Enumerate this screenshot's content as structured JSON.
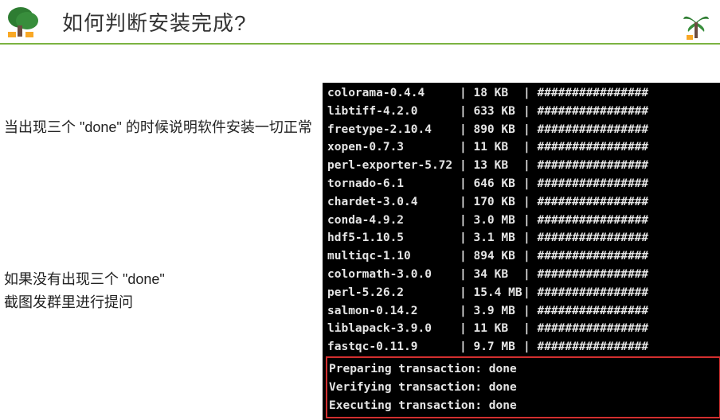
{
  "header": {
    "title": "如何判断安装完成?"
  },
  "instructions": {
    "line1": "当出现三个 \"done\" 的时候说明软件安装一切正常",
    "line2a": "如果没有出现三个 \"done\"",
    "line2b": "截图发群里进行提问"
  },
  "packages": [
    {
      "name": "colorama-0.4.4",
      "size": "18 KB"
    },
    {
      "name": "libtiff-4.2.0",
      "size": "633 KB"
    },
    {
      "name": "freetype-2.10.4",
      "size": "890 KB"
    },
    {
      "name": "xopen-0.7.3",
      "size": "11 KB"
    },
    {
      "name": "perl-exporter-5.72",
      "size": "13 KB"
    },
    {
      "name": "tornado-6.1",
      "size": "646 KB"
    },
    {
      "name": "chardet-3.0.4",
      "size": "170 KB"
    },
    {
      "name": "conda-4.9.2",
      "size": "3.0 MB"
    },
    {
      "name": "hdf5-1.10.5",
      "size": "3.1 MB"
    },
    {
      "name": "multiqc-1.10",
      "size": "894 KB"
    },
    {
      "name": "colormath-3.0.0",
      "size": "34 KB"
    },
    {
      "name": "perl-5.26.2",
      "size": "15.4 MB"
    },
    {
      "name": "salmon-0.14.2",
      "size": "3.9 MB"
    },
    {
      "name": "liblapack-3.9.0",
      "size": "11 KB"
    },
    {
      "name": "fastqc-0.11.9",
      "size": "9.7 MB"
    }
  ],
  "barSegment": "################",
  "transactions": [
    "Preparing transaction: done",
    "Verifying transaction: done",
    "Executing transaction: done"
  ]
}
